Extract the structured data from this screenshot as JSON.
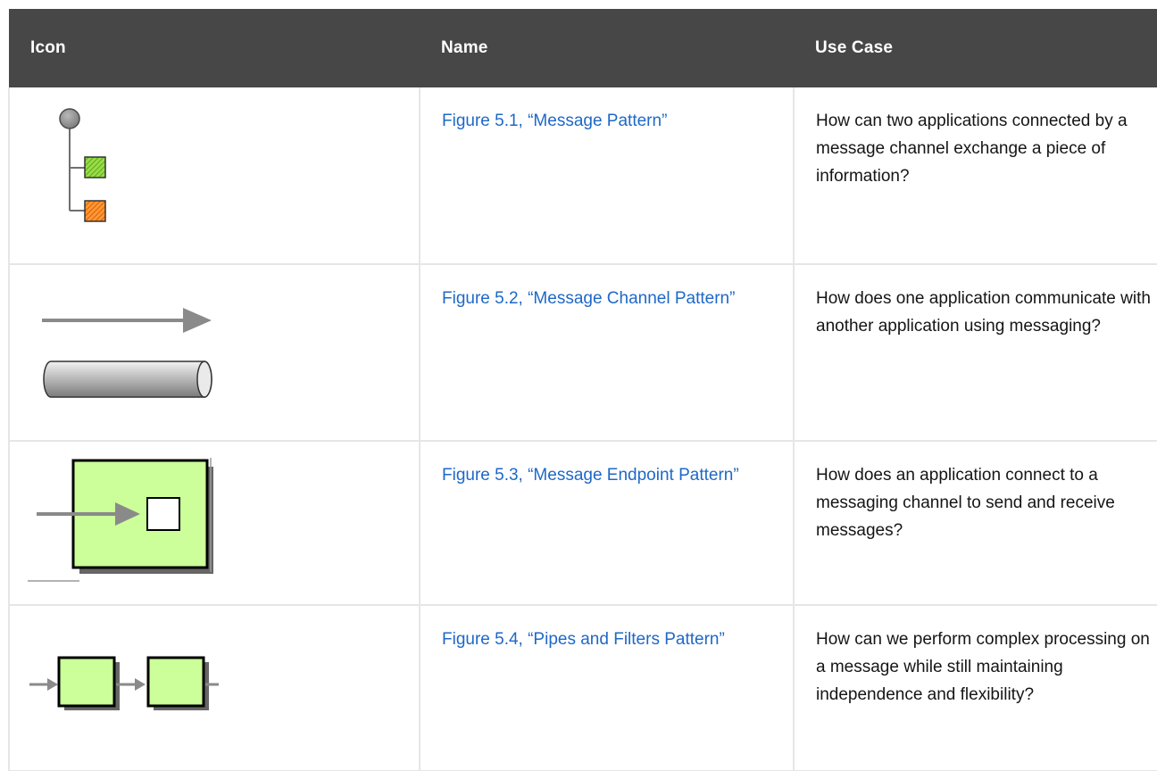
{
  "table": {
    "headers": {
      "icon": "Icon",
      "name": "Name",
      "use_case": "Use Case"
    },
    "rows": [
      {
        "icon": "message-pattern-icon",
        "name": "Figure 5.1, “Message Pattern”",
        "use_case": "How can two applications connected by a message channel exchange a piece of information?"
      },
      {
        "icon": "message-channel-icon",
        "name": "Figure 5.2, “Message Channel Pattern”",
        "use_case": "How does one application communicate with another application using messaging?"
      },
      {
        "icon": "message-endpoint-icon",
        "name": "Figure 5.3, “Message Endpoint Pattern”",
        "use_case": "How does an application connect to a messaging channel to send and receive messages?"
      },
      {
        "icon": "pipes-and-filters-icon",
        "name": "Figure 5.4, “Pipes and Filters Pattern”",
        "use_case": "How can we perform complex processing on a message while still maintaining independence and flexibility?"
      }
    ]
  },
  "colors": {
    "header_bg": "#474747",
    "link": "#1e68c8",
    "icon_green": "#ccff99",
    "icon_gray": "#8a8a8a"
  }
}
